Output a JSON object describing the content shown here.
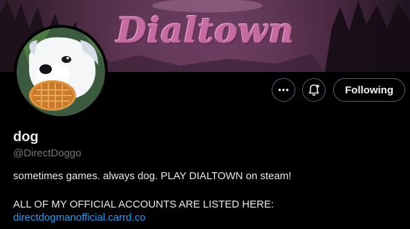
{
  "banner": {
    "title": "Dialtown"
  },
  "profile": {
    "name": "dog",
    "handle": "@DirectDoggo",
    "bio_line1": "sometimes games. always dog. PLAY DIALTOWN on steam!",
    "bio_line2": "ALL OF MY OFFICIAL ACCOUNTS ARE LISTED HERE:",
    "link": "directdogmanofficial.carrd.co"
  },
  "actions": {
    "more_icon": "more-horizontal-icon",
    "notify_icon": "bell-plus-icon",
    "following_label": "Following"
  },
  "colors": {
    "background": "#000000",
    "text": "#e7e9ea",
    "muted": "#71767b",
    "link": "#1d9bf0",
    "border": "#536471",
    "banner_accent": "#c56aa2"
  }
}
